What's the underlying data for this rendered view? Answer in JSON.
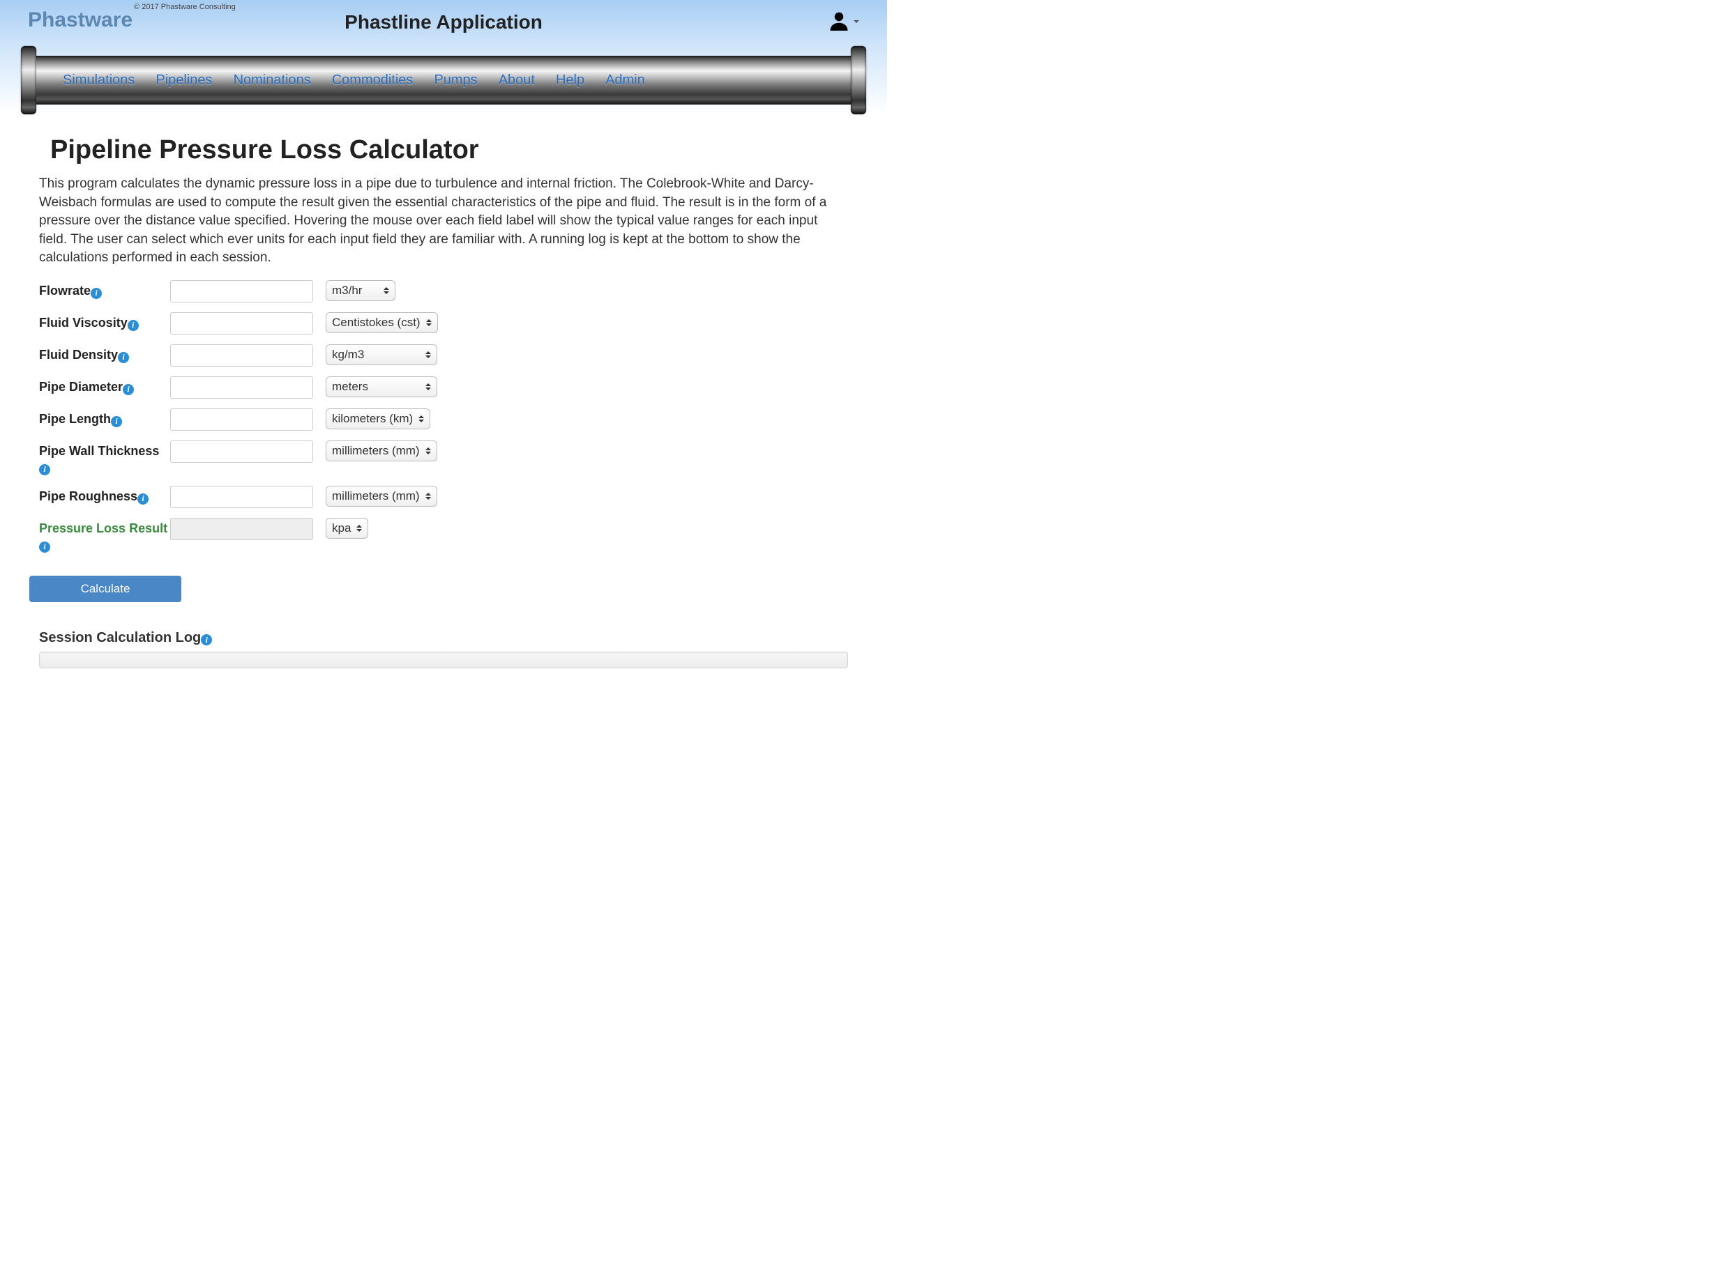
{
  "header": {
    "brand": "Phastware",
    "copyright": "© 2017 Phastware Consulting",
    "app_title": "Phastline Application"
  },
  "nav": {
    "items": [
      "Simulations",
      "Pipelines",
      "Nominations",
      "Commodities",
      "Pumps",
      "About",
      "Help",
      "Admin"
    ]
  },
  "page": {
    "title": "Pipeline Pressure Loss Calculator",
    "description": "This program calculates the dynamic pressure loss in a pipe due to turbulence and internal friction. The Colebrook-White and Darcy-Weisbach formulas are used to compute the result given the essential characteristics of the pipe and fluid. The result is in the form of a pressure over the distance value specified. Hovering the mouse over each field label will show the typical value ranges for each input field. The user can select which ever units for each input field they are familiar with. A running log is kept at the bottom to show the calculations performed in each session."
  },
  "form": {
    "flowrate": {
      "label": "Flowrate",
      "value": "",
      "unit": "m3/hr"
    },
    "viscosity": {
      "label": "Fluid Viscosity",
      "value": "",
      "unit": "Centistokes (cst)"
    },
    "density": {
      "label": "Fluid Density",
      "value": "",
      "unit": "kg/m3"
    },
    "diameter": {
      "label": "Pipe Diameter",
      "value": "",
      "unit": "meters"
    },
    "length": {
      "label": "Pipe Length",
      "value": "",
      "unit": "kilometers (km)"
    },
    "wall_thickness": {
      "label": "Pipe Wall Thickness",
      "value": "",
      "unit": "millimeters (mm)"
    },
    "roughness": {
      "label": "Pipe Roughness",
      "value": "",
      "unit": "millimeters (mm)"
    },
    "result": {
      "label": "Pressure Loss Result",
      "value": "",
      "unit": "kpa"
    }
  },
  "buttons": {
    "calculate": "Calculate"
  },
  "log": {
    "title": "Session Calculation Log",
    "content": ""
  }
}
